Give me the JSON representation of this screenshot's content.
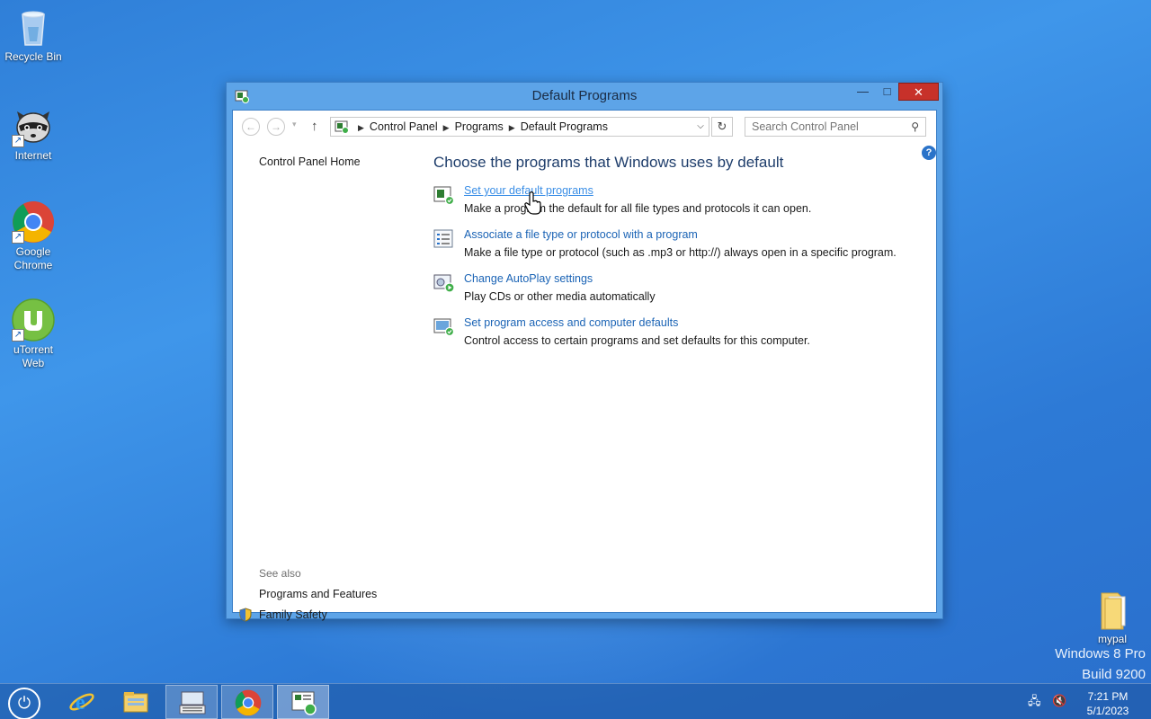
{
  "desktop": {
    "icons": [
      {
        "label": "Recycle Bin"
      },
      {
        "label": "Internet"
      },
      {
        "label": "Google Chrome"
      },
      {
        "label": "uTorrent Web"
      },
      {
        "label": "mypal"
      }
    ],
    "watermark_line1": "Windows 8 Pro",
    "watermark_line2": "Build 9200"
  },
  "window": {
    "title": "Default Programs",
    "controls": {
      "minimize": "—",
      "maximize": "□",
      "close": "✕"
    },
    "breadcrumbs": [
      "Control Panel",
      "Programs",
      "Default Programs"
    ],
    "search_placeholder": "Search Control Panel",
    "left_pane": {
      "home_link": "Control Panel Home",
      "see_also_title": "See also",
      "see_also_links": [
        "Programs and Features",
        "Family Safety"
      ]
    },
    "main": {
      "heading": "Choose the programs that Windows uses by default",
      "tasks": [
        {
          "link": "Set your default programs",
          "desc": "Make a program the default for all file types and protocols it can open."
        },
        {
          "link": "Associate a file type or protocol with a program",
          "desc": "Make a file type or protocol (such as .mp3 or http://) always open in a specific program."
        },
        {
          "link": "Change AutoPlay settings",
          "desc": "Play CDs or other media automatically"
        },
        {
          "link": "Set program access and computer defaults",
          "desc": "Control access to certain programs and set defaults for this computer."
        }
      ]
    }
  },
  "taskbar": {
    "items": [
      "internet-explorer",
      "file-explorer",
      "on-screen-keyboard",
      "google-chrome",
      "control-panel"
    ],
    "clock_time": "7:21 PM",
    "clock_date": "5/1/2023"
  },
  "colors": {
    "link": "#1a63b5",
    "heading": "#1e3d6b",
    "close": "#c7312a"
  }
}
